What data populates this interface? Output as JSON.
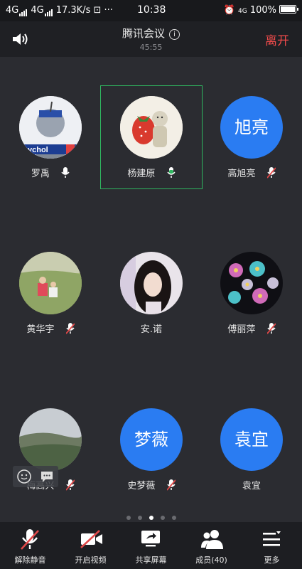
{
  "status_bar": {
    "net1": "4G",
    "net2": "4G",
    "speed": "17.3K/s",
    "extra": "⊡ ···",
    "time": "10:38",
    "net_right": "4G",
    "battery": "100%"
  },
  "header": {
    "title": "腾讯会议",
    "timer": "45:55",
    "leave_label": "离开"
  },
  "participants": [
    {
      "name": "罗禹",
      "avatar_text": "",
      "mic": "on-white"
    },
    {
      "name": "杨建原",
      "avatar_text": "",
      "mic": "speaking-green"
    },
    {
      "name": "高旭亮",
      "avatar_text": "旭亮",
      "mic": "muted"
    },
    {
      "name": "黄华宇",
      "avatar_text": "",
      "mic": "muted"
    },
    {
      "name": "安.诺",
      "avatar_text": "",
      "mic": "none"
    },
    {
      "name": "傅丽萍",
      "avatar_text": "",
      "mic": "muted"
    },
    {
      "name": "梅高兴",
      "avatar_text": "",
      "mic": "muted"
    },
    {
      "name": "史梦薇",
      "avatar_text": "梦薇",
      "mic": "muted"
    },
    {
      "name": "袁宜",
      "avatar_text": "袁宜",
      "mic": "none"
    }
  ],
  "avatar_fragments": {
    "robot_text": "ychol"
  },
  "toolbar": {
    "unmute": "解除静音",
    "video": "开启视频",
    "share": "共享屏幕",
    "members": "成员(40)",
    "more": "更多"
  },
  "colors": {
    "accent_blue": "#2a7cf2",
    "leave_red": "#f04b4b",
    "speaking_green": "#2fb760",
    "muted_red": "#e14848"
  },
  "page_count": 5,
  "current_page": 3
}
